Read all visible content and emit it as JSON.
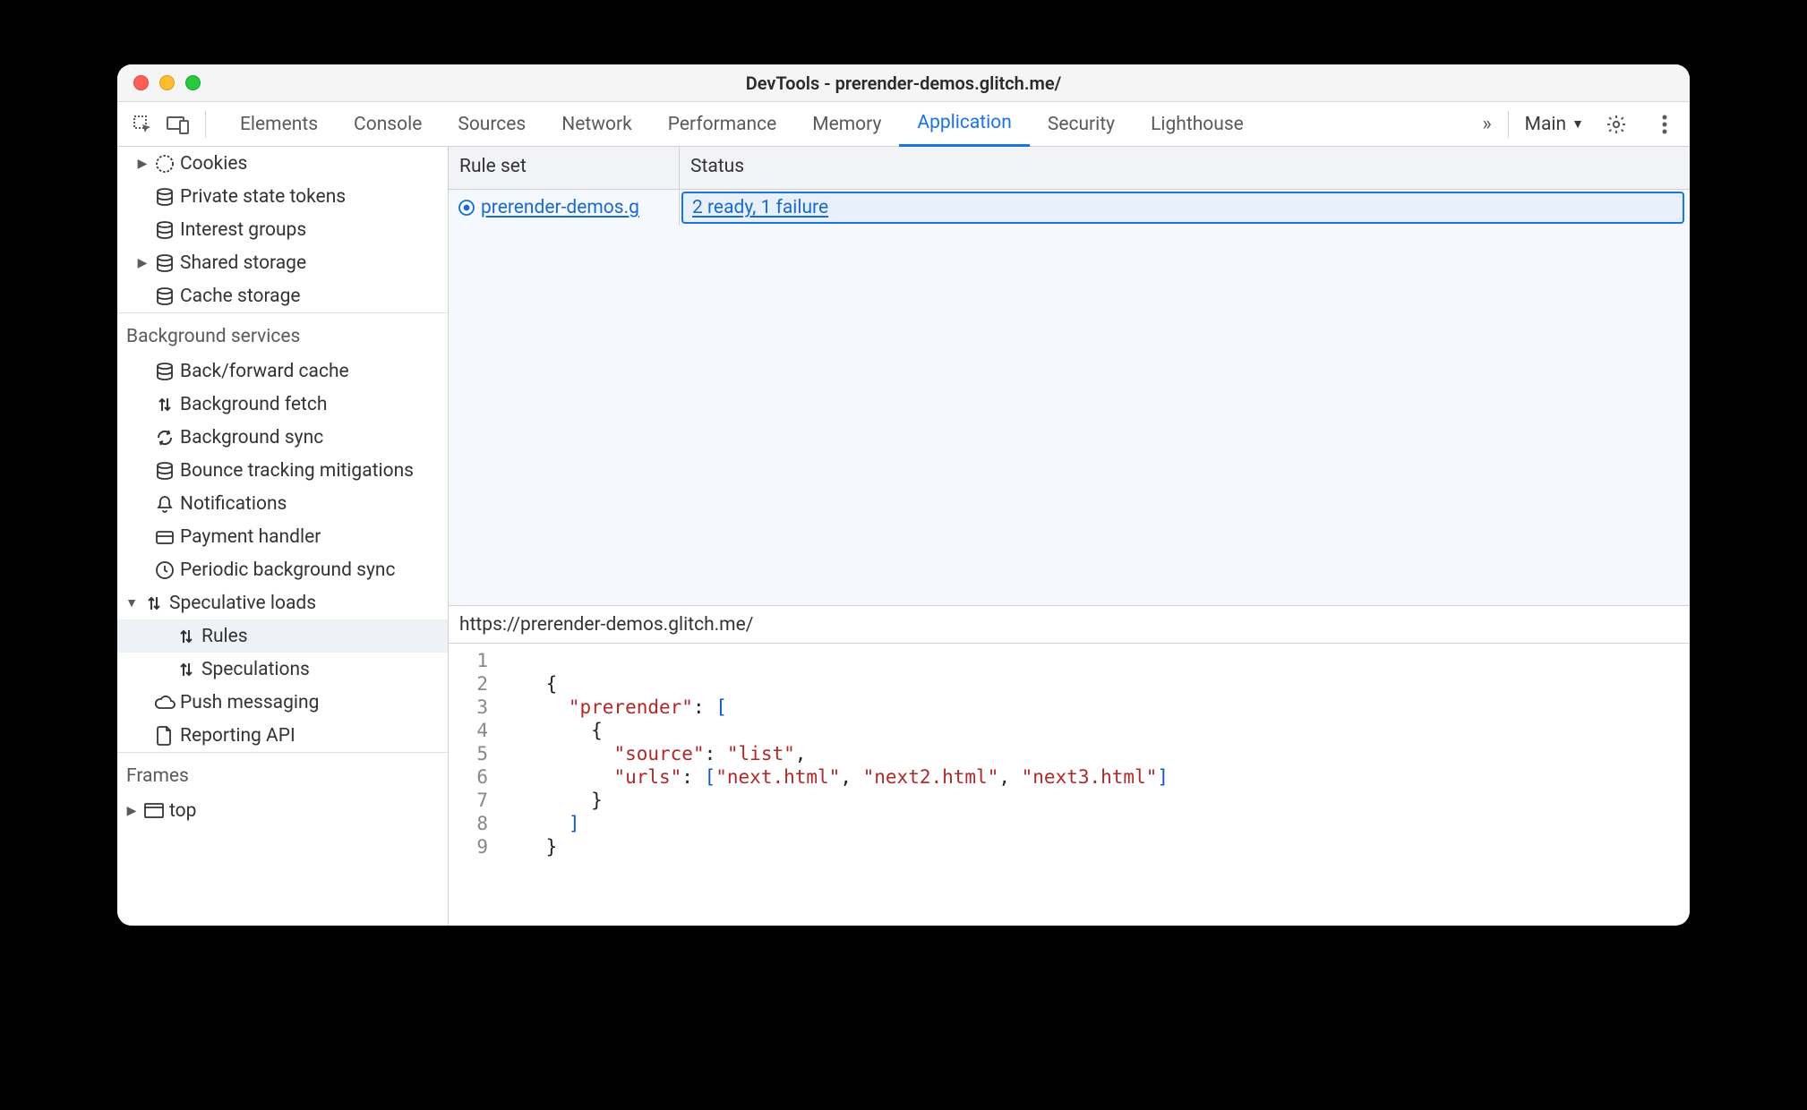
{
  "window": {
    "title": "DevTools - prerender-demos.glitch.me/"
  },
  "toolbar": {
    "tabs": [
      "Elements",
      "Console",
      "Sources",
      "Network",
      "Performance",
      "Memory",
      "Application",
      "Security",
      "Lighthouse"
    ],
    "active_tab": "Application",
    "overflow": "»",
    "target_label": "Main"
  },
  "sidebar": {
    "storage_items": [
      {
        "label": "Cookies",
        "icon": "cookie",
        "arrow": "right"
      },
      {
        "label": "Private state tokens",
        "icon": "db"
      },
      {
        "label": "Interest groups",
        "icon": "db"
      },
      {
        "label": "Shared storage",
        "icon": "db",
        "arrow": "right"
      },
      {
        "label": "Cache storage",
        "icon": "db"
      }
    ],
    "bg_header": "Background services",
    "bg_items": [
      {
        "label": "Back/forward cache",
        "icon": "db"
      },
      {
        "label": "Background fetch",
        "icon": "updown"
      },
      {
        "label": "Background sync",
        "icon": "sync"
      },
      {
        "label": "Bounce tracking mitigations",
        "icon": "db"
      },
      {
        "label": "Notifications",
        "icon": "bell"
      },
      {
        "label": "Payment handler",
        "icon": "card"
      },
      {
        "label": "Periodic background sync",
        "icon": "clock"
      },
      {
        "label": "Speculative loads",
        "icon": "updown",
        "arrow": "down"
      },
      {
        "label": "Rules",
        "icon": "updown",
        "indent": 2,
        "selected": true
      },
      {
        "label": "Speculations",
        "icon": "updown",
        "indent": 2
      },
      {
        "label": "Push messaging",
        "icon": "cloud"
      },
      {
        "label": "Reporting API",
        "icon": "doc"
      }
    ],
    "frames_header": "Frames",
    "frames_items": [
      {
        "label": "top",
        "icon": "frame",
        "arrow": "right"
      }
    ]
  },
  "grid": {
    "col_ruleset": "Rule set",
    "col_status": "Status",
    "row": {
      "ruleset_link": "prerender-demos.g",
      "status_link": "2 ready, 1 failure"
    }
  },
  "detail": {
    "url": "https://prerender-demos.glitch.me/",
    "code": {
      "lines": [
        "1",
        "2",
        "3",
        "4",
        "5",
        "6",
        "7",
        "8",
        "9"
      ],
      "key_prerender": "\"prerender\"",
      "key_source": "\"source\"",
      "key_urls": "\"urls\"",
      "val_list": "\"list\"",
      "url1": "\"next.html\"",
      "url2": "\"next2.html\"",
      "url3": "\"next3.html\""
    }
  }
}
